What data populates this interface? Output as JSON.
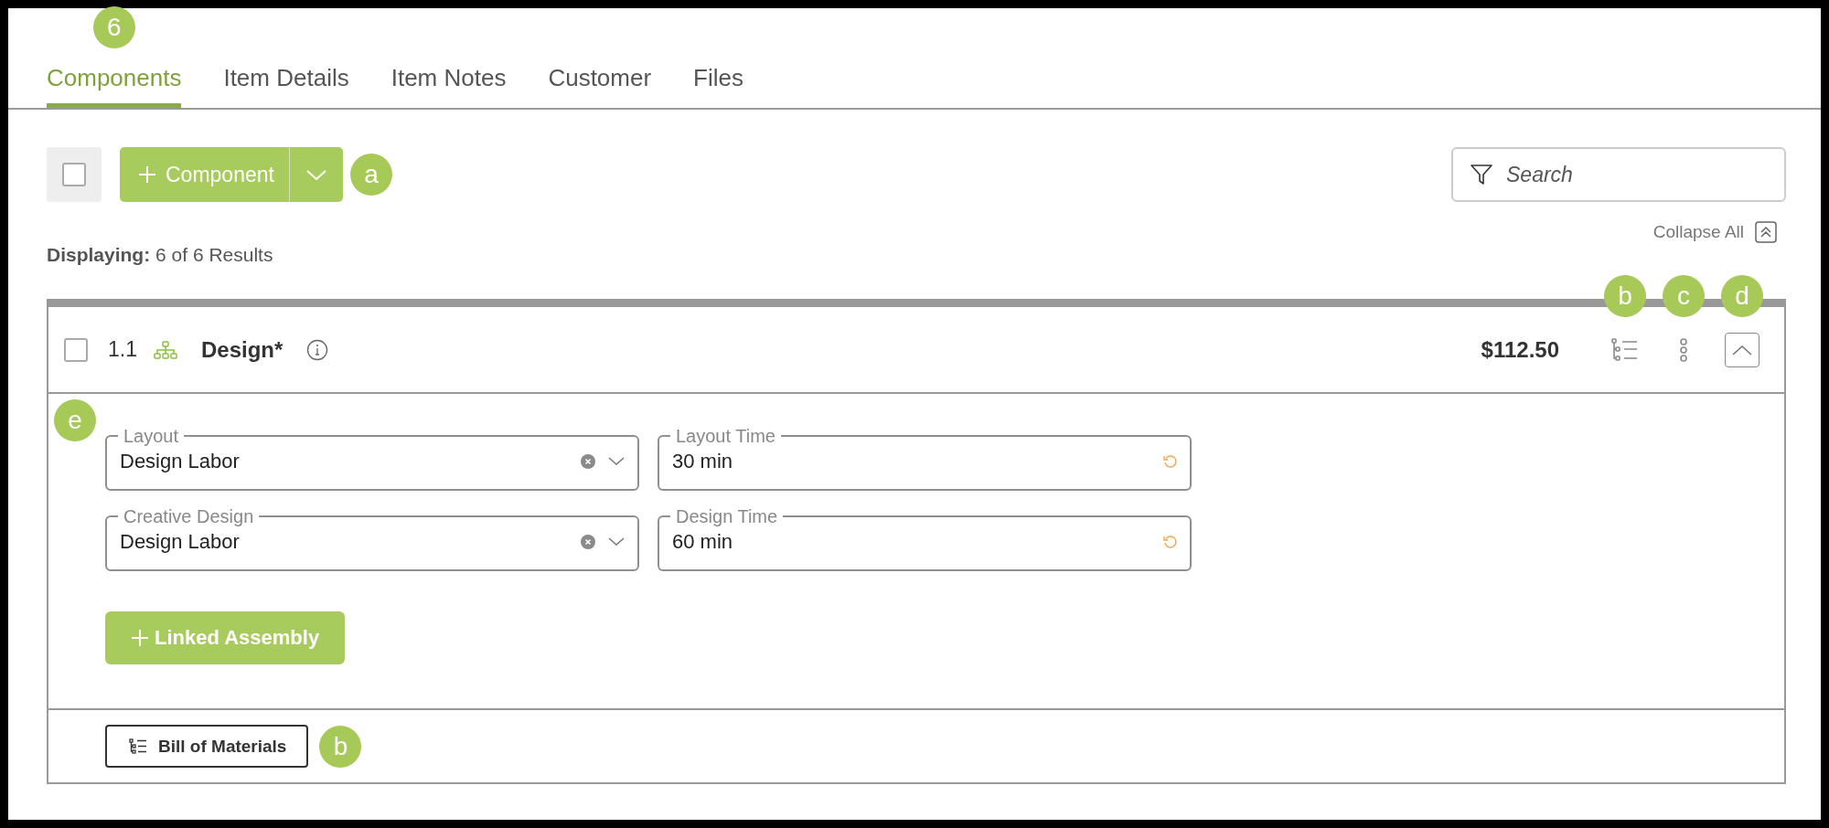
{
  "tabs": [
    {
      "label": "Components",
      "selected": true,
      "callout": "6"
    },
    {
      "label": "Item Details",
      "selected": false
    },
    {
      "label": "Item Notes",
      "selected": false
    },
    {
      "label": "Customer",
      "selected": false
    },
    {
      "label": "Files",
      "selected": false
    }
  ],
  "toolbar": {
    "select_all": {
      "checked": false
    },
    "add_button": {
      "label": "Component",
      "callout": "a"
    },
    "search": {
      "placeholder": "Search"
    }
  },
  "results": {
    "label": "Displaying:",
    "text": "6 of 6 Results"
  },
  "collapse_all": {
    "label": "Collapse All"
  },
  "component": {
    "checked": false,
    "number": "1.1",
    "name": "Design*",
    "price": "$112.50",
    "expanded": true,
    "callout": "e",
    "actions": [
      {
        "kind": "bom",
        "callout": "b"
      },
      {
        "kind": "menu",
        "callout": "c"
      },
      {
        "kind": "collapse",
        "callout": "d"
      }
    ],
    "fields": [
      {
        "kind": "select",
        "label": "Layout",
        "value": "Design Labor"
      },
      {
        "kind": "time",
        "label": "Layout Time",
        "value": "30 min"
      },
      {
        "kind": "select",
        "label": "Creative Design",
        "value": "Design Labor"
      },
      {
        "kind": "time",
        "label": "Design Time",
        "value": "60 min"
      }
    ],
    "linked_button": {
      "label": "Linked Assembly"
    },
    "bom_button": {
      "label": "Bill of Materials",
      "callout": "b"
    }
  }
}
